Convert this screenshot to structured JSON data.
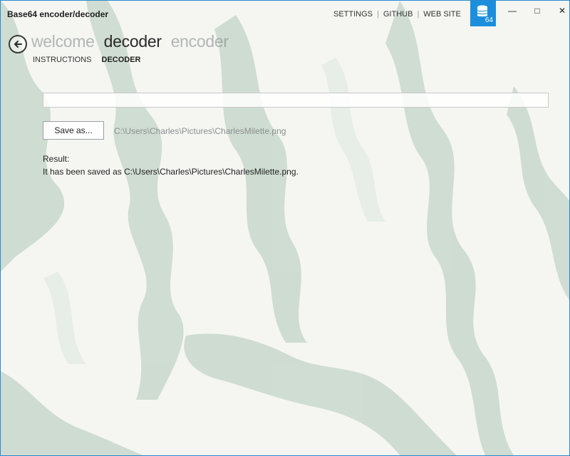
{
  "window": {
    "title": "Base64 encoder/decoder",
    "controls": {
      "minimize": "—",
      "maximize": "□",
      "close": "✕"
    }
  },
  "top_links": [
    {
      "label": "SETTINGS"
    },
    {
      "label": "GITHUB"
    },
    {
      "label": "WEB SITE"
    }
  ],
  "app_badge": {
    "number": "64",
    "icon": "database-icon",
    "color": "#1c8fdc"
  },
  "pivot": {
    "items": [
      {
        "label": "welcome",
        "active": false
      },
      {
        "label": "decoder",
        "active": true
      },
      {
        "label": "encoder",
        "active": false
      }
    ]
  },
  "subnav": {
    "items": [
      {
        "label": "INSTRUCTIONS",
        "active": false
      },
      {
        "label": "DECODER",
        "active": true
      }
    ]
  },
  "decoder": {
    "input_value": "",
    "save_button_label": "Save as...",
    "save_path": "C:\\Users\\Charles\\Pictures\\CharlesMilette.png",
    "result_label": "Result:",
    "result_message": "It has been saved as C:\\Users\\Charles\\Pictures\\CharlesMilette.png."
  }
}
